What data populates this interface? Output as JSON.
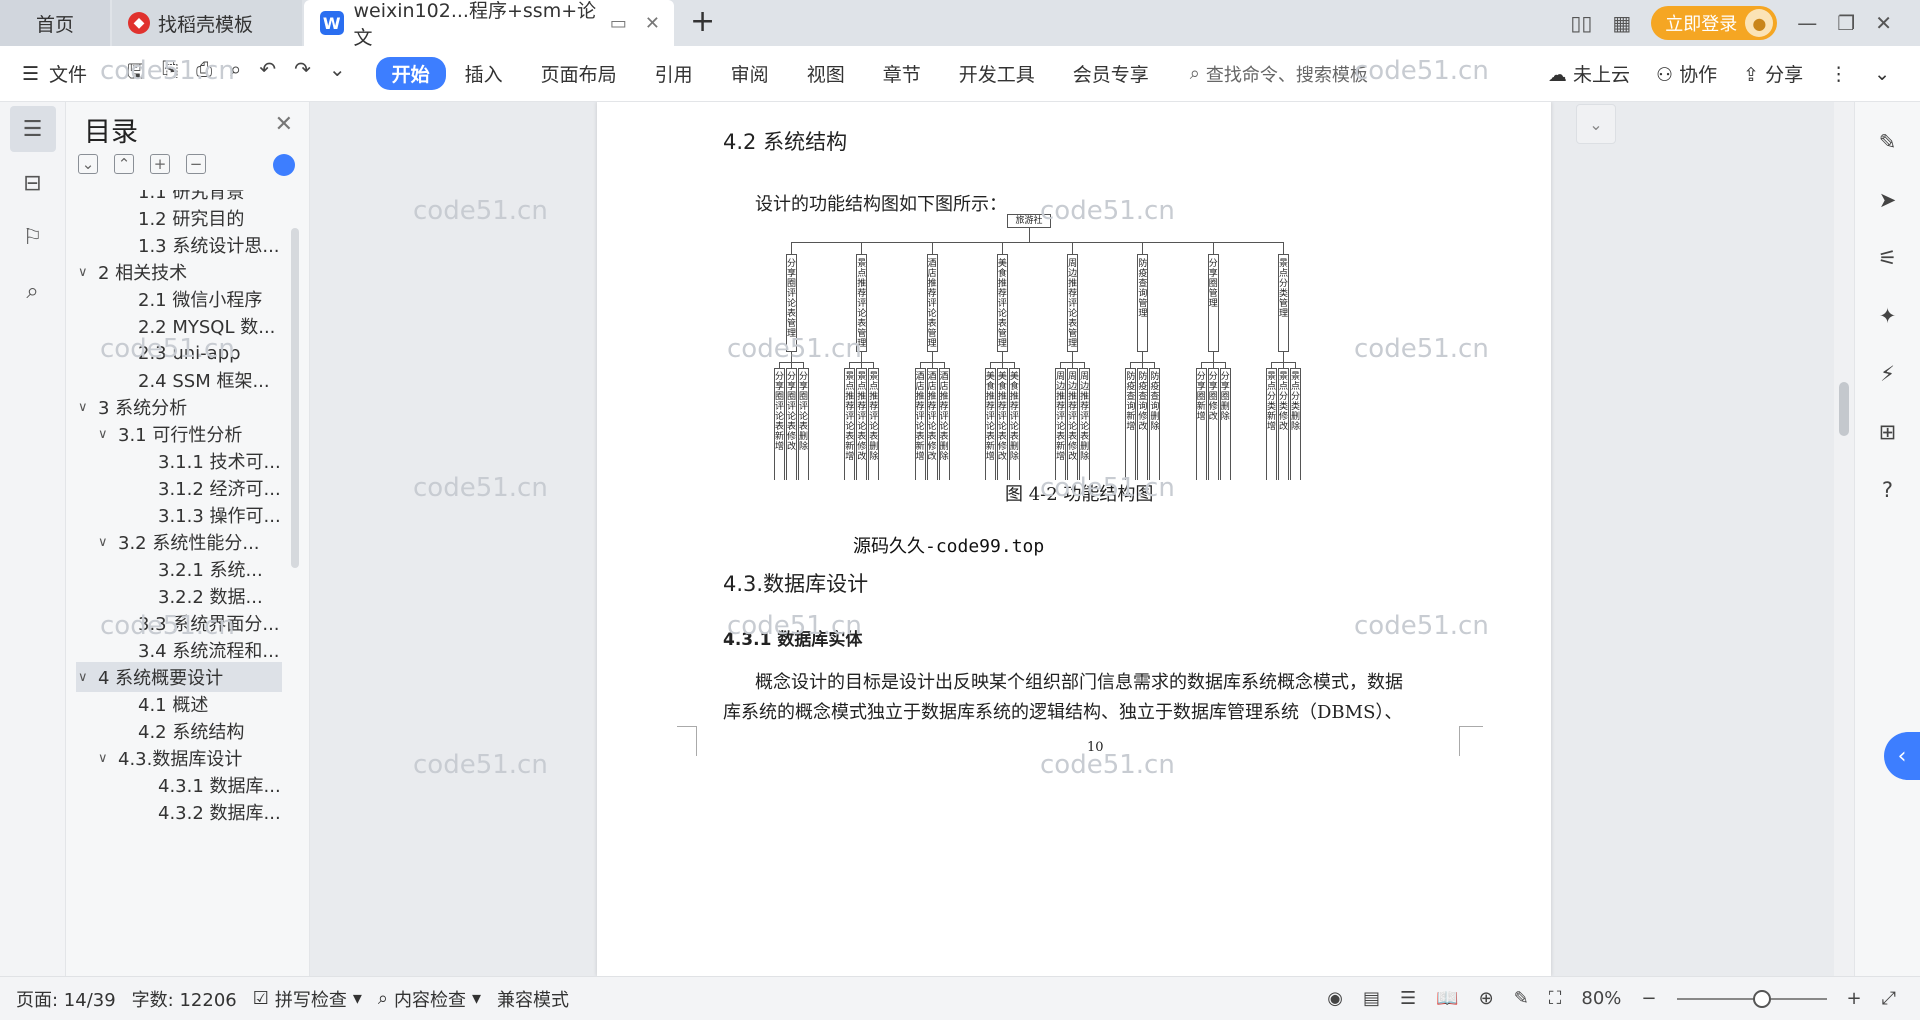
{
  "tabs": {
    "home": "首页",
    "template": "找稻壳模板",
    "doc": "weixin102...程序+ssm+论文"
  },
  "header_right": {
    "login": "立即登录"
  },
  "toolbar": {
    "file": "文件",
    "menu_tabs": [
      "开始",
      "插入",
      "页面布局",
      "引用",
      "审阅",
      "视图",
      "章节",
      "开发工具",
      "会员专享"
    ],
    "search_placeholder": "查找命令、搜索模板",
    "cloud": "未上云",
    "collab": "协作",
    "share": "分享"
  },
  "toc": {
    "title": "目录",
    "items": [
      {
        "text": "1.1 研究背景",
        "level": 2,
        "chev": ""
      },
      {
        "text": "1.2 研究目的",
        "level": 2,
        "chev": ""
      },
      {
        "text": "1.3 系统设计思...",
        "level": 2,
        "chev": ""
      },
      {
        "text": "2 相关技术",
        "level": 1,
        "chev": "v"
      },
      {
        "text": "2.1 微信小程序",
        "level": 2,
        "chev": ""
      },
      {
        "text": "2.2 MYSQL 数...",
        "level": 2,
        "chev": ""
      },
      {
        "text": "2.3 uni-app",
        "level": 2,
        "chev": ""
      },
      {
        "text": "2.4 SSM 框架...",
        "level": 2,
        "chev": ""
      },
      {
        "text": "3 系统分析",
        "level": 1,
        "chev": "v"
      },
      {
        "text": "3.1 可行性分析",
        "level": 2,
        "chev": "v"
      },
      {
        "text": "3.1.1 技术可...",
        "level": 3,
        "chev": ""
      },
      {
        "text": "3.1.2 经济可...",
        "level": 3,
        "chev": ""
      },
      {
        "text": "3.1.3 操作可...",
        "level": 3,
        "chev": ""
      },
      {
        "text": "3.2 系统性能分...",
        "level": 2,
        "chev": "v"
      },
      {
        "text": "3.2.1 系统...",
        "level": 3,
        "chev": ""
      },
      {
        "text": "3.2.2 数据...",
        "level": 3,
        "chev": ""
      },
      {
        "text": "3.3 系统界面分...",
        "level": 2,
        "chev": ""
      },
      {
        "text": "3.4 系统流程和...",
        "level": 2,
        "chev": ""
      },
      {
        "text": "4 系统概要设计",
        "level": 1,
        "chev": "v",
        "selected": true
      },
      {
        "text": "4.1 概述",
        "level": 2,
        "chev": ""
      },
      {
        "text": "4.2 系统结构",
        "level": 2,
        "chev": ""
      },
      {
        "text": "4.3.数据库设计",
        "level": 2,
        "chev": "v"
      },
      {
        "text": "4.3.1 数据库...",
        "level": 3,
        "chev": ""
      },
      {
        "text": "4.3.2 数据库...",
        "level": 3,
        "chev": ""
      }
    ]
  },
  "document": {
    "heading_42": "4.2 系统结构",
    "intro": "设计的功能结构图如下图所示：",
    "caption": "图 4-2 功能结构图",
    "heading_43": "4.3.数据库设计",
    "heading_431": "4.3.1 数据库实体",
    "para_line1": "概念设计的目标是设计出反映某个组织部门信息需求的数据库系统概念模式，数据",
    "para_line2": "库系统的概念模式独立于数据库系统的逻辑结构、独立于数据库管理系统（DBMS）、",
    "page_number": "10",
    "diagram_watermark": "源码久久-code99.top",
    "diagram": {
      "root": "旅游社",
      "modules": [
        {
          "name": "分享圈评论表管理",
          "children": [
            "分享圈评论表新增",
            "分享圈评论表修改",
            "分享圈评论表删除"
          ]
        },
        {
          "name": "景点推荐评论表管理",
          "children": [
            "景点推荐评论表新增",
            "景点推荐评论表修改",
            "景点推荐评论表删除"
          ]
        },
        {
          "name": "酒店推荐评论表管理",
          "children": [
            "酒店推荐评论表新增",
            "酒店推荐评论表修改",
            "酒店推荐评论表删除"
          ]
        },
        {
          "name": "美食推荐评论表管理",
          "children": [
            "美食推荐评论表新增",
            "美食推荐评论表修改",
            "美食推荐评论表删除"
          ]
        },
        {
          "name": "周边推荐评论表管理",
          "children": [
            "周边推荐评论表新增",
            "周边推荐评论表修改",
            "周边推荐评论表删除"
          ]
        },
        {
          "name": "防疫查询管理",
          "children": [
            "防疫查询新增",
            "防疫查询修改",
            "防疫查询删除"
          ]
        },
        {
          "name": "分享圈管理",
          "children": [
            "分享圈新增",
            "分享圈修改",
            "分享圈删除"
          ]
        },
        {
          "name": "景点分类管理",
          "children": [
            "景点分类新增",
            "景点分类修改",
            "景点分类删除"
          ]
        }
      ]
    }
  },
  "watermark": "code51.cn",
  "status": {
    "page": "页面: 14/39",
    "words": "字数: 12206",
    "spell": "拼写检查",
    "content_check": "内容检查",
    "compat": "兼容模式",
    "zoom": "80%"
  },
  "colors": {
    "accent": "#3d7eff",
    "login": "#f5a623"
  }
}
